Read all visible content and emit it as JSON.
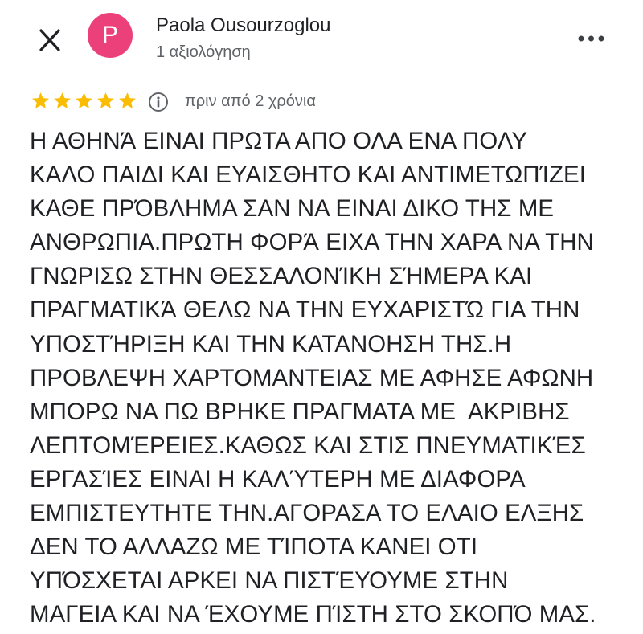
{
  "header": {
    "close_icon": "close-icon",
    "avatar_letter": "P",
    "avatar_color": "#ec407a",
    "author_name": "Paola Ousourzoglou",
    "review_count": "1 αξιολόγηση",
    "more_icon": "more-horizontal-icon"
  },
  "review": {
    "rating": 5,
    "max_rating": 5,
    "star_color": "#fbbc04",
    "info_icon": "info-icon",
    "date": "πριν από 2 χρόνια",
    "lines": [
      "Η ΑΘΗΝΆ ΕΙΝΑΙ ΠΡΩΤΑ ΑΠΟ ΟΛΑ ΕΝΑ ΠΟΛΥ",
      "ΚΑΛΟ ΠΑΙΔΙ ΚΑΙ ΕΥΑΙΣΘΗΤΟ ΚΑΙ ΑΝΤΙΜΕΤΩΠΊΖΕΙ",
      "ΚΑΘΕ ΠΡΌΒΛΗΜΑ ΣΑΝ ΝΑ ΕΙΝΑΙ ΔΙΚΟ ΤΗΣ ΜΕ",
      "ΑΝΘΡΩΠΙΑ.ΠΡΩΤΗ ΦΟΡΆ ΕΙΧΑ ΤΗΝ ΧΑΡΑ ΝΑ ΤΗΝ",
      "ΓΝΩΡΙΣΩ ΣΤΗΝ ΘΕΣΣΑΛΟΝΊΚΗ ΣΉΜΕΡΑ ΚΑΙ",
      "ΠΡΑΓΜΑΤΙΚΆ ΘΕΛΩ ΝΑ ΤΗΝ ΕΥΧΑΡΙΣΤΏ ΓΙΑ ΤΗΝ",
      "ΥΠΟΣΤΉΡΙΞΗ ΚΑΙ ΤΗΝ ΚΑΤΑΝΟΗΣΗ ΤΗΣ.Η",
      "ΠΡΟΒΛΕΨΗ ΧΑΡΤΟΜΑΝΤΕΙΑΣ ΜΕ ΑΦΗΣΕ ΑΦΩΝΗ",
      "ΜΠΟΡΩ ΝΑ ΠΩ ΒΡΗΚΕ ΠΡΑΓΜΑΤΑ ΜΕ  ΑΚΡΙΒΗΣ",
      "ΛΕΠΤΟΜΈΡΕΙΕΣ.ΚΑΘΩΣ ΚΑΙ ΣΤΙΣ ΠΝΕΥΜΑΤΙΚΈΣ",
      "ΕΡΓΑΣΊΕΣ ΕΙΝΑΙ Η ΚΑΛΎΤΕΡΗ ΜΕ ΔΙΑΦΟΡΑ",
      "ΕΜΠΙΣΤΕΥΤΗΤΕ ΤΗΝ.ΑΓΟΡΑΣΑ ΤΟ ΕΛΑΙΟ ΕΛΞΗΣ",
      "ΔΕΝ ΤΟ ΑΛΛΑΖΩ ΜΕ ΤΊΠΟΤΑ ΚΑΝΕΙ ΟΤΙ",
      "ΥΠΌΣΧΕΤΑΙ ΑΡΚΕΙ ΝΑ ΠΙΣΤΈΥΟΥΜΕ ΣΤΗΝ",
      "ΜΑΓΕΙΑ ΚΑΙ ΝΑ ΈΧΟΥΜΕ ΠΊΣΤΗ ΣΤΟ ΣΚΟΠΌ ΜΑΣ."
    ]
  }
}
